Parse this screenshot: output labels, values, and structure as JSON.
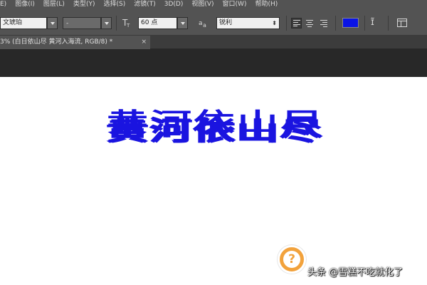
{
  "menubar": {
    "items": [
      "E)",
      "图像(I)",
      "图层(L)",
      "类型(Y)",
      "选择(S)",
      "滤镜(T)",
      "3D(D)",
      "视图(V)",
      "窗口(W)",
      "帮助(H)"
    ]
  },
  "options": {
    "font_family": "文琥珀",
    "font_style": "-",
    "font_size": "60 点",
    "antialias": "锐利",
    "text_color": "#0a14e6"
  },
  "document": {
    "tab_title": "3% (白日依山尽 黄河入海流, RGB/8) *",
    "close_glyph": "×",
    "canvas_text": "黄河依山尽"
  },
  "watermark": {
    "badge_glyph": "?",
    "text": "头条 @雪糕不吃就化了"
  }
}
